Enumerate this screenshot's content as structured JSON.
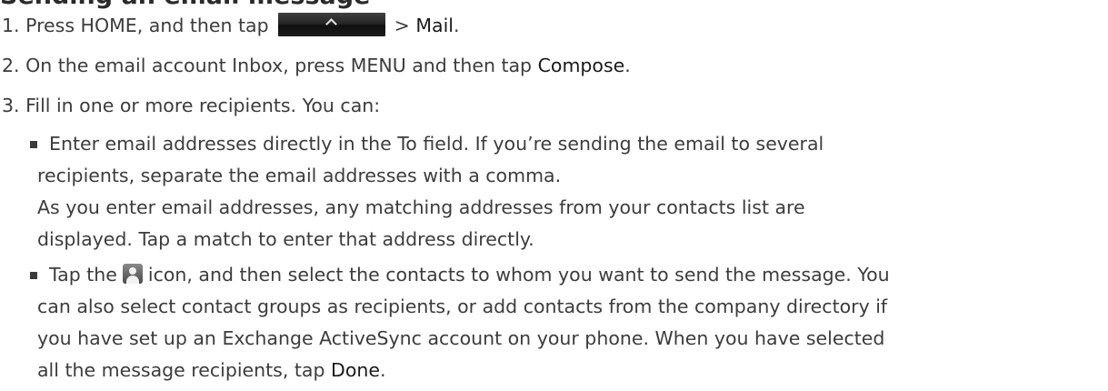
{
  "heading": "Sending an email message",
  "steps": {
    "step1": {
      "before": "1.  Press HOME, and then tap",
      "after": "> ",
      "target": "Mail",
      "end": "."
    },
    "step2": {
      "before": "2. On the email account Inbox, press MENU and then tap ",
      "target": "Compose",
      "end": "."
    },
    "step3": {
      "text": "3. Fill in one or more recipients. You can:"
    }
  },
  "bullets": {
    "first": {
      "line1": "Enter email addresses directly in the To field. If you’re sending the email to several",
      "line2": "recipients, separate the email addresses with a comma.",
      "line3": "As you enter email addresses, any matching addresses from your contacts list are",
      "line4": "displayed. Tap a match to enter that address directly."
    },
    "second": {
      "line1_before": "Tap the",
      "line1_after": "icon, and then select the contacts to whom you want to send the message. You",
      "line2": "can also select contact groups as recipients, or add contacts from the company directory if",
      "line3": "you have set up an Exchange ActiveSync account on your phone. When you have selected",
      "line4_before": "all the message recipients, tap ",
      "line4_target": "Done",
      "line4_end": "."
    }
  },
  "icons": {
    "tab_button": "chevron-up-icon",
    "contacts": "contact-person-icon"
  }
}
